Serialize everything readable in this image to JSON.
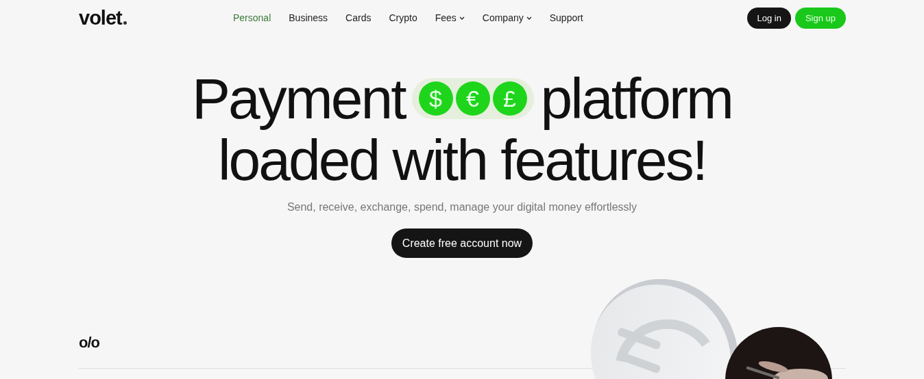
{
  "header": {
    "logo": "volet",
    "nav": [
      {
        "label": "Personal",
        "selected": true,
        "dropdown": false
      },
      {
        "label": "Business",
        "selected": false,
        "dropdown": false
      },
      {
        "label": "Cards",
        "selected": false,
        "dropdown": false
      },
      {
        "label": "Crypto",
        "selected": false,
        "dropdown": false
      },
      {
        "label": "Fees",
        "selected": false,
        "dropdown": true
      },
      {
        "label": "Company",
        "selected": false,
        "dropdown": true
      },
      {
        "label": "Support",
        "selected": false,
        "dropdown": false
      }
    ],
    "buttons": [
      {
        "label": "Log in",
        "kind": "dark"
      },
      {
        "label": "Sign up",
        "kind": "green"
      }
    ]
  },
  "hero": {
    "title_start": "Payment",
    "currencies": [
      "$",
      "€",
      "£"
    ],
    "title_end": "platform",
    "title_line2": "loaded with features!",
    "subtitle": "Send, receive, exchange, spend, manage your digital money effortlessly",
    "cta": "Create free account now"
  },
  "section": {
    "mark": "o/o"
  }
}
